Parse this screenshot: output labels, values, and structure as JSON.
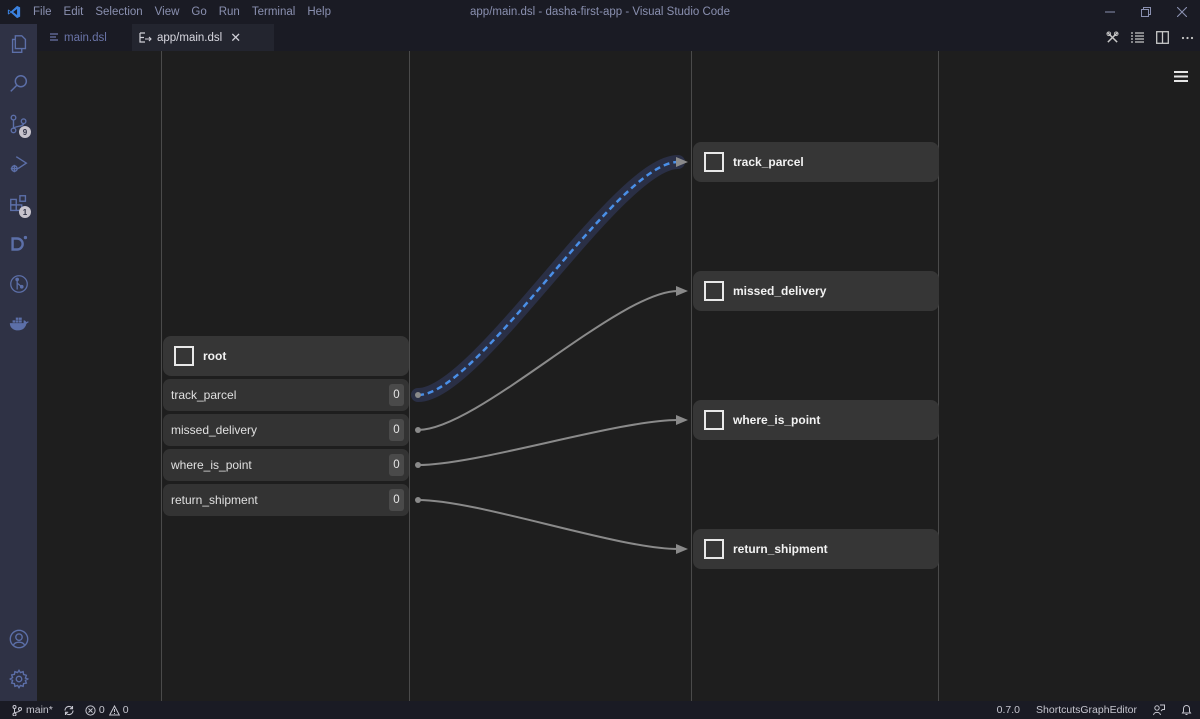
{
  "window": {
    "title": "app/main.dsl - dasha-first-app - Visual Studio Code",
    "menu": [
      "File",
      "Edit",
      "Selection",
      "View",
      "Go",
      "Run",
      "Terminal",
      "Help"
    ]
  },
  "activity_bar": {
    "items": [
      {
        "name": "explorer-icon"
      },
      {
        "name": "search-icon"
      },
      {
        "name": "source-control-icon",
        "badge": "9"
      },
      {
        "name": "run-debug-icon"
      },
      {
        "name": "extensions-icon",
        "badge": "1"
      },
      {
        "name": "dasha-icon"
      },
      {
        "name": "git-graph-icon"
      },
      {
        "name": "docker-icon"
      }
    ],
    "bottom": [
      {
        "name": "account-icon"
      },
      {
        "name": "settings-gear-icon"
      }
    ]
  },
  "tabs": [
    {
      "label": "main.dsl",
      "active": false
    },
    {
      "label": "app/main.dsl",
      "active": true
    }
  ],
  "graph": {
    "root": {
      "label": "root",
      "transitions": [
        {
          "label": "track_parcel",
          "count": "0",
          "target": "track_parcel",
          "highlighted": true
        },
        {
          "label": "missed_delivery",
          "count": "0",
          "target": "missed_delivery",
          "highlighted": false
        },
        {
          "label": "where_is_point",
          "count": "0",
          "target": "where_is_point",
          "highlighted": false
        },
        {
          "label": "return_shipment",
          "count": "0",
          "target": "return_shipment",
          "highlighted": false
        }
      ]
    },
    "targets": [
      {
        "label": "track_parcel"
      },
      {
        "label": "missed_delivery"
      },
      {
        "label": "where_is_point"
      },
      {
        "label": "return_shipment"
      }
    ],
    "colors": {
      "highlight": "#4a8fe7",
      "edge": "#8a8a8a"
    }
  },
  "statusbar": {
    "branch": "main*",
    "errors": "0",
    "warnings": "0",
    "version": "0.7.0",
    "editor_name": "ShortcutsGraphEditor"
  }
}
